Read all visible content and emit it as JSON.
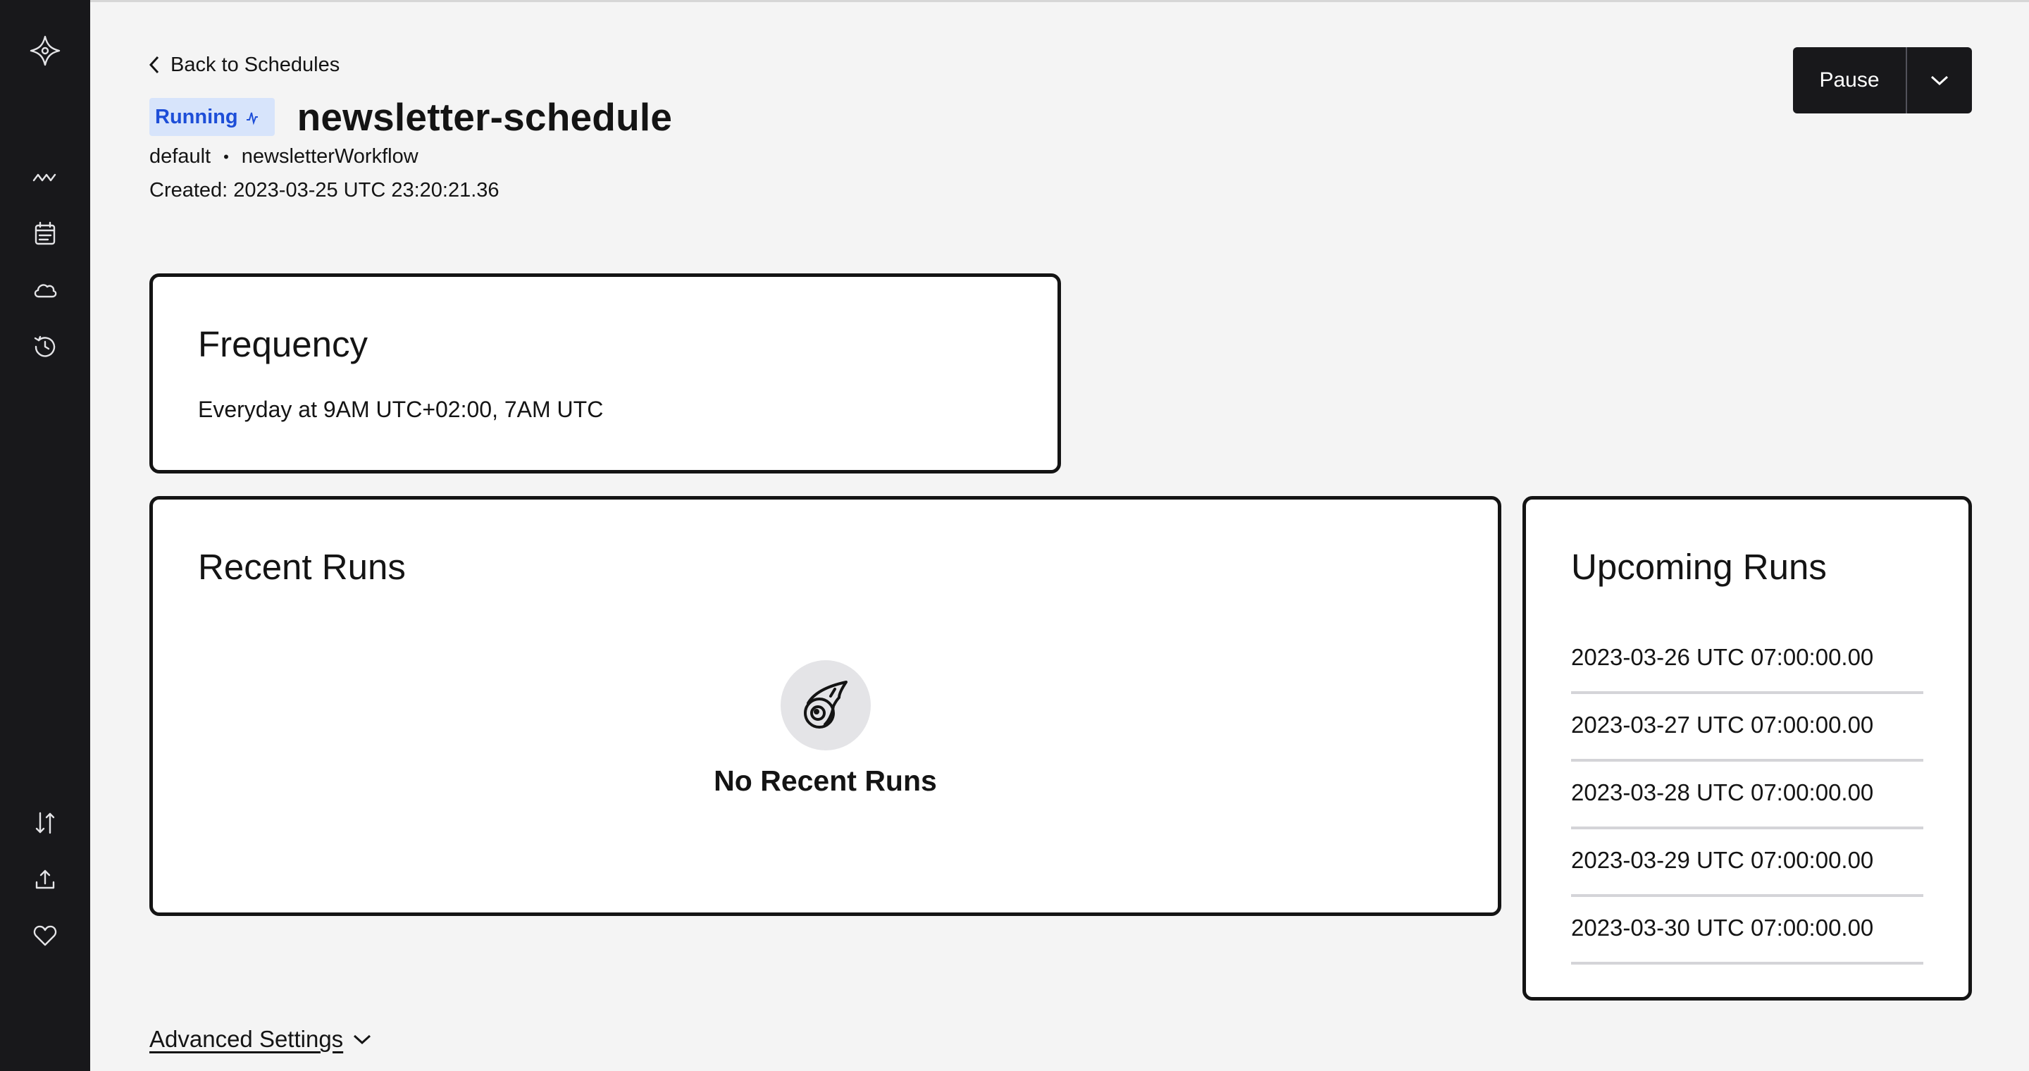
{
  "nav": {
    "back_label": "Back to Schedules"
  },
  "schedule": {
    "status": "Running",
    "name": "newsletter-schedule",
    "namespace": "default",
    "separator": "•",
    "workflow_type": "newsletterWorkflow",
    "created": "Created: 2023-03-25 UTC 23:20:21.36"
  },
  "actions": {
    "pause_label": "Pause"
  },
  "frequency": {
    "heading": "Frequency",
    "description": "Everyday at 9AM UTC+02:00, 7AM UTC"
  },
  "recent_runs": {
    "heading": "Recent Runs",
    "empty_message": "No Recent Runs"
  },
  "upcoming_runs": {
    "heading": "Upcoming Runs",
    "items": [
      "2023-03-26 UTC 07:00:00.00",
      "2023-03-27 UTC 07:00:00.00",
      "2023-03-28 UTC 07:00:00.00",
      "2023-03-29 UTC 07:00:00.00",
      "2023-03-30 UTC 07:00:00.00"
    ]
  },
  "advanced_settings": {
    "label": "Advanced Settings"
  },
  "icons": {
    "sidebar_top": [
      "logo-icon",
      "workflows-icon",
      "schedules-icon",
      "cloud-icon",
      "history-icon"
    ],
    "sidebar_bottom": [
      "import-export-icon",
      "upload-icon",
      "heart-icon"
    ]
  },
  "colors": {
    "sidebar": "#18181b",
    "badge_bg": "#d7e4fb",
    "badge_text": "#1d4ed8",
    "background": "#f4f4f4"
  }
}
